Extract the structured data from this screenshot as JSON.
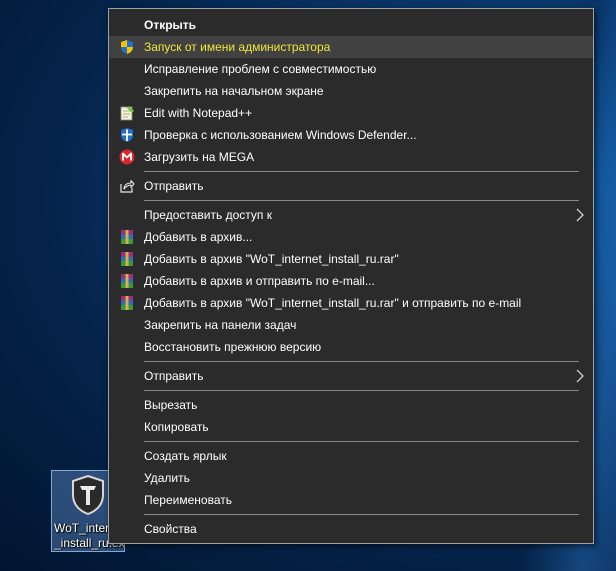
{
  "menu": {
    "open": "Открыть",
    "run_as_admin": "Запуск от имени администратора",
    "compat": "Исправление проблем с совместимостью",
    "pin_start": "Закрепить на начальном экране",
    "notepad": "Edit with Notepad++",
    "defender": "Проверка с использованием Windows Defender...",
    "mega": "Загрузить на MEGA",
    "share": "Отправить",
    "give_access": "Предоставить доступ к",
    "add_archive": "Добавить в архив...",
    "add_rar": "Добавить в архив \"WoT_internet_install_ru.rar\"",
    "add_email": "Добавить в архив и отправить по e-mail...",
    "add_rar_email": "Добавить в архив \"WoT_internet_install_ru.rar\" и отправить по e-mail",
    "pin_taskbar": "Закрепить на панели задач",
    "restore": "Восстановить прежнюю версию",
    "send_to": "Отправить",
    "cut": "Вырезать",
    "copy": "Копировать",
    "create_shortcut": "Создать ярлык",
    "delete": "Удалить",
    "rename": "Переименовать",
    "properties": "Свойства"
  },
  "desktop": {
    "file_caption": "WoT_internet_install_ru.exe",
    "file_caption_display": "WoT_intern\n_install_ru.exe"
  },
  "colors": {
    "menu_bg": "#2b2b2b",
    "highlight_bg": "#414141",
    "highlight_text": "#f0e63a"
  }
}
